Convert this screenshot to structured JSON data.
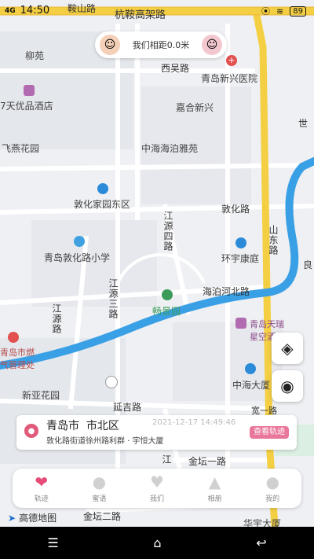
{
  "status_bar": {
    "network": "4G",
    "time": "14:50",
    "battery": "89"
  },
  "map": {
    "labels": {
      "anshan_road": "鞍山路",
      "hangan_road": "杭鞍高架路",
      "liuyuan": "柳苑",
      "xiwu_road": "西吴路",
      "qingdao_xinxing_hospital": "青岛新兴医院",
      "hotel": "7天优品酒店",
      "jiahe_xinxing": "嘉合新兴",
      "feiyan_garden": "飞燕花园",
      "zhonghai_yayuan": "中海海泊雅苑",
      "dunhua_home_east": "敦化家园东区",
      "dunhua_road": "敦化路",
      "jiangyuan_4": "江源四路",
      "shandong_road": "山东路",
      "dunhua_school": "青岛敦化路小学",
      "huanyu_kangting": "环宇康庭",
      "jiangyuan_3": "江源三路",
      "haibohe_road": "海泊河北路",
      "changjing_garden": "畅景园",
      "jiangyuan_road": "江源路",
      "tianrui_hotel": "青岛天瑞星空酒店",
      "ranqi_office": "青岛市燃气管理处",
      "zhonghai_mansion": "中海大厦",
      "xinya_garden": "新亚花园",
      "yanji_road": "延吉路",
      "jintan_1": "金坛一路",
      "jintan_2": "金坛二路",
      "huayu_mansion": "华宇大厦",
      "liang": "良",
      "kuan_road": "宽一路",
      "jiang_xiu": "江",
      "shi_jing": "世"
    }
  },
  "distance": {
    "text": "我们相距0.0米"
  },
  "location_card": {
    "city": "青岛市  市北区",
    "time": "2021-12-17 14:49:46",
    "address": "敦化路街道徐州路利群 · 宇恒大厦",
    "track_button": "查看轨迹"
  },
  "tabs": [
    {
      "label": "轨迹",
      "icon": "heart-track-icon",
      "active": true
    },
    {
      "label": "蜜语",
      "icon": "chat-bubble-icon",
      "active": false
    },
    {
      "label": "我们",
      "icon": "heart-icon",
      "active": false
    },
    {
      "label": "相册",
      "icon": "mountain-photo-icon",
      "active": false
    },
    {
      "label": "我的",
      "icon": "person-icon",
      "active": false
    }
  ],
  "amap_logo": "高德地图",
  "colors": {
    "accent": "#e74c79",
    "river": "#3aa0e6",
    "highway": "#f4cf43"
  }
}
